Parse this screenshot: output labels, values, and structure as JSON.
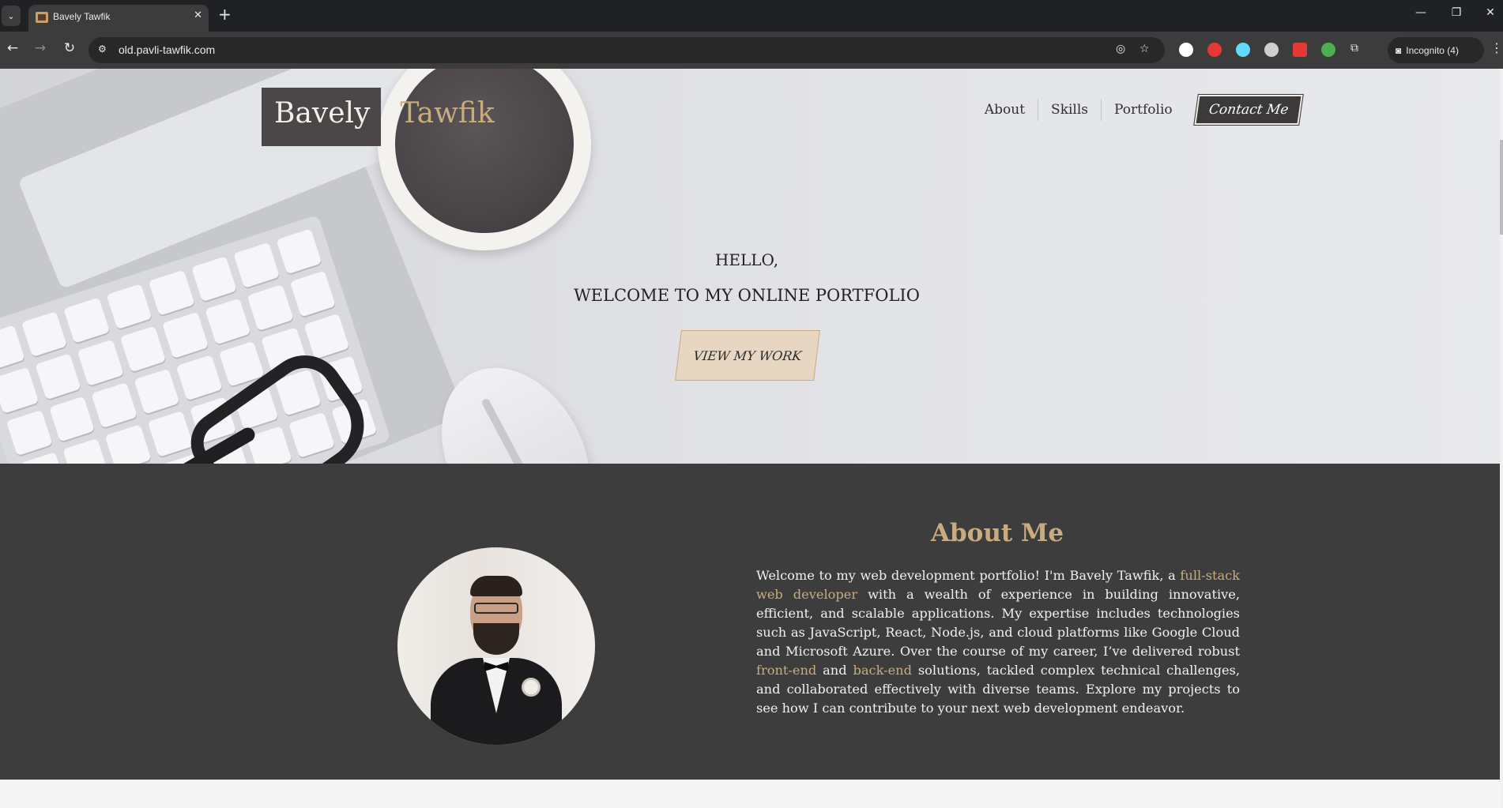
{
  "browser": {
    "tab_title": "Bavely Tawfik",
    "url": "old.pavli-tawfik.com",
    "incognito_label": "Incognito (4)",
    "tab_list_glyph": "⌄",
    "tab_close_glyph": "✕",
    "new_tab_glyph": "+",
    "minimize_glyph": "—",
    "restore_glyph": "❐",
    "close_glyph": "✕",
    "back_glyph": "←",
    "forward_glyph": "→",
    "reload_glyph": "↻",
    "site_info_glyph": "⚙",
    "eye_glyph": "◎",
    "star_glyph": "☆",
    "extensions_glyph": "⧉",
    "menu_glyph": "⋮",
    "incognito_glyph": "◙",
    "extension_colors": [
      "#ffffff",
      "#e53935",
      "#61dafb",
      "#cfcfcf",
      "#e53935",
      "#4caf50"
    ]
  },
  "header": {
    "logo_first": "Bavely",
    "logo_last": "Tawfik",
    "nav": [
      "About",
      "Skills",
      "Portfolio"
    ],
    "contact_label": "Contact Me"
  },
  "hero": {
    "greeting": "HELLO,",
    "welcome": "WELCOME TO MY ONLINE PORTFOLIO",
    "cta_label": "VIEW MY WORK"
  },
  "about": {
    "title": "About Me",
    "text_1": "Welcome to my web development portfolio! I'm Bavely Tawfik, a ",
    "hl_1": "full-stack web developer",
    "text_2": " with a wealth of experience in building innovative, efficient, and scalable applications. My expertise includes technologies such as JavaScript, React, Node.js, and cloud platforms like Google Cloud and Microsoft Azure. Over the course of my career, I’ve delivered robust ",
    "hl_2": "front-end",
    "text_3": " and ",
    "hl_3": "back-end",
    "text_4": " solutions, tackled complex technical challenges, and collaborated effectively with diverse teams. Explore my projects to see how I can contribute to your next web development endeavor."
  },
  "colors": {
    "accent": "#c9ac7e",
    "dark": "#3d3d3d",
    "chrome": "#202124"
  }
}
